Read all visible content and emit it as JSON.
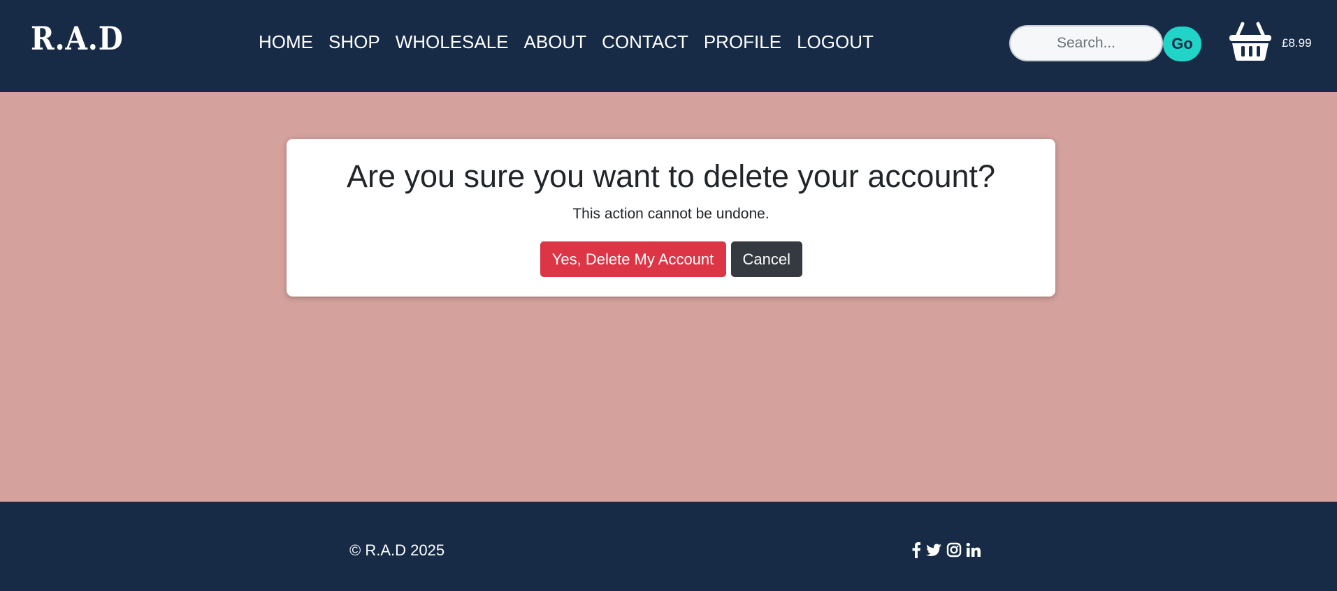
{
  "header": {
    "logo": "R.A.D",
    "nav": [
      "HOME",
      "SHOP",
      "WHOLESALE",
      "ABOUT",
      "CONTACT",
      "PROFILE",
      "LOGOUT"
    ],
    "search": {
      "placeholder": "Search...",
      "value": ""
    },
    "search_button": "Go",
    "basket_icon": "shopping-basket-icon",
    "basket_total": "£8.99"
  },
  "dialog": {
    "title": "Are you sure you want to delete your account?",
    "message": "This action cannot be undone.",
    "confirm_label": "Yes, Delete My Account",
    "cancel_label": "Cancel"
  },
  "footer": {
    "copyright": "© R.A.D 2025",
    "social_icons": [
      "facebook-icon",
      "twitter-icon",
      "instagram-icon",
      "linkedin-icon"
    ]
  },
  "colors": {
    "header_bg": "#172b47",
    "page_bg": "#d4a19d",
    "accent": "#20d4c7",
    "danger": "#dc3545",
    "dark": "#343a40"
  }
}
